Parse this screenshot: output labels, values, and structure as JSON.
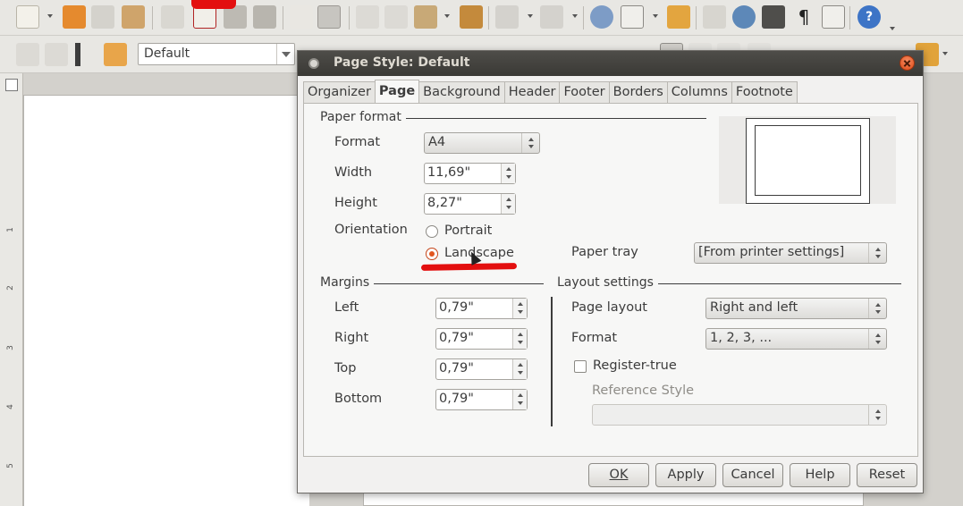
{
  "app": {
    "paragraph_style": "Default",
    "ruler_numbers": [
      "1",
      "2",
      "3",
      "4",
      "5"
    ],
    "toolbar_icons": [
      "new-document-icon",
      "open-folder-icon",
      "save-icon",
      "send-icon",
      "edit-file-icon",
      "export-pdf-icon",
      "print-icon",
      "print-preview-icon",
      "spellcheck-icon",
      "autospellcheck-icon",
      "cut-icon",
      "copy-icon",
      "paste-icon",
      "format-paintbrush-icon",
      "undo-icon",
      "redo-icon",
      "hyperlink-icon",
      "table-icon",
      "draw-functions-icon",
      "find-replace-icon",
      "navigator-icon",
      "gallery-icon",
      "formatting-marks-icon",
      "zoom-icon",
      "help-icon"
    ]
  },
  "dialog": {
    "title": "Page Style: Default",
    "tabs": [
      {
        "label": "Organizer",
        "active": false
      },
      {
        "label": "Page",
        "active": true
      },
      {
        "label": "Background",
        "active": false
      },
      {
        "label": "Header",
        "active": false
      },
      {
        "label": "Footer",
        "active": false
      },
      {
        "label": "Borders",
        "active": false
      },
      {
        "label": "Columns",
        "active": false
      },
      {
        "label": "Footnote",
        "active": false
      }
    ],
    "paper_format": {
      "section_label": "Paper format",
      "format_label": "Format",
      "format_value": "A4",
      "width_label": "Width",
      "width_value": "11,69\"",
      "height_label": "Height",
      "height_value": "8,27\"",
      "orientation_label": "Orientation",
      "portrait_label": "Portrait",
      "landscape_label": "Landscape",
      "orientation_selected": "Landscape",
      "paper_tray_label": "Paper tray",
      "paper_tray_value": "[From printer settings]"
    },
    "margins": {
      "section_label": "Margins",
      "left_label": "Left",
      "left_value": "0,79\"",
      "right_label": "Right",
      "right_value": "0,79\"",
      "top_label": "Top",
      "top_value": "0,79\"",
      "bottom_label": "Bottom",
      "bottom_value": "0,79\""
    },
    "layout": {
      "section_label": "Layout settings",
      "page_layout_label": "Page layout",
      "page_layout_value": "Right and left",
      "format_label": "Format",
      "format_value": "1, 2, 3, ...",
      "register_true_label": "Register-true",
      "register_true_checked": false,
      "reference_style_label": "Reference Style",
      "reference_style_value": ""
    },
    "buttons": {
      "ok": "OK",
      "apply": "Apply",
      "cancel": "Cancel",
      "help": "Help",
      "reset": "Reset"
    }
  },
  "colors": {
    "accent": "#e2561f",
    "annotation_red": "#e30f0f",
    "titlebar": "#3f3e3a"
  }
}
